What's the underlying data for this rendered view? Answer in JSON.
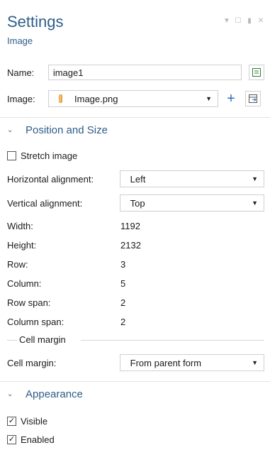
{
  "header": {
    "title": "Settings",
    "subtitle": "Image"
  },
  "name": {
    "label": "Name:",
    "value": "image1"
  },
  "image": {
    "label": "Image:",
    "value": "Image.png"
  },
  "position_section": {
    "title": "Position and Size"
  },
  "stretch": {
    "label": "Stretch image",
    "checked": false
  },
  "h_align": {
    "label": "Horizontal alignment:",
    "value": "Left"
  },
  "v_align": {
    "label": "Vertical alignment:",
    "value": "Top"
  },
  "props": [
    {
      "label": "Width:",
      "value": "1192"
    },
    {
      "label": "Height:",
      "value": "2132"
    },
    {
      "label": "Row:",
      "value": "3"
    },
    {
      "label": "Column:",
      "value": "5"
    },
    {
      "label": "Row span:",
      "value": "2"
    },
    {
      "label": "Column span:",
      "value": "2"
    }
  ],
  "cell_margin_group": {
    "title": "Cell margin"
  },
  "cell_margin": {
    "label": "Cell margin:",
    "value": "From parent form"
  },
  "appearance_section": {
    "title": "Appearance"
  },
  "visible": {
    "label": "Visible",
    "checked": true
  },
  "enabled": {
    "label": "Enabled",
    "checked": true
  },
  "colors": {
    "accent": "#2f5d8a",
    "border": "#cfcfcf"
  }
}
